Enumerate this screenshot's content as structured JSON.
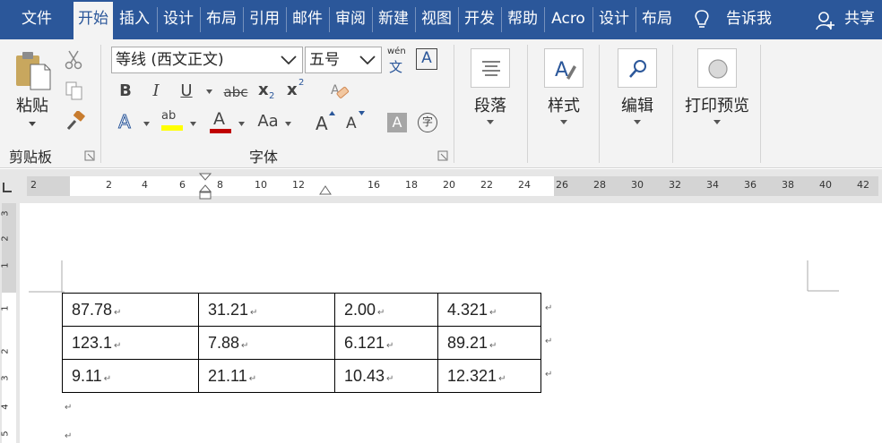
{
  "tabs": [
    {
      "label": "文件"
    },
    {
      "label": "开始"
    },
    {
      "label": "插入"
    },
    {
      "label": "设计"
    },
    {
      "label": "布局"
    },
    {
      "label": "引用"
    },
    {
      "label": "邮件"
    },
    {
      "label": "审阅"
    },
    {
      "label": "新建"
    },
    {
      "label": "视图"
    },
    {
      "label": "开发"
    },
    {
      "label": "帮助"
    },
    {
      "label": "Acro"
    },
    {
      "label": "设计"
    },
    {
      "label": "布局"
    }
  ],
  "active_tab": "开始",
  "tell_me": {
    "label": "告诉我"
  },
  "share": {
    "label": "共享"
  },
  "ribbon": {
    "clipboard": {
      "paste_label": "粘贴",
      "group_label": "剪贴板"
    },
    "font": {
      "font_name": "等线 (西文正文)",
      "font_size": "五号",
      "wen_top": "wén",
      "wen_bottom": "文",
      "boxed_a": "A",
      "bold": "B",
      "italic": "I",
      "underline": "U",
      "strike": "abc",
      "sub": "x",
      "sub_mark": "2",
      "sup": "x",
      "sup_mark": "2",
      "text_effect": "A",
      "highlight": "ab",
      "font_color": "A",
      "change_case": "Aa",
      "grow": "A",
      "shrink": "A",
      "shade_a": "A",
      "enclose": "字",
      "group_label": "字体"
    },
    "paragraph": {
      "label": "段落"
    },
    "styles": {
      "label": "样式"
    },
    "editing": {
      "label": "编辑"
    },
    "print_preview": {
      "label": "打印预览"
    }
  },
  "ruler": {
    "numbers": [
      "2",
      "2",
      "4",
      "6",
      "8",
      "10",
      "12",
      "16",
      "18",
      "20",
      "22",
      "24",
      "26",
      "28",
      "30",
      "32",
      "34",
      "36",
      "38",
      "40",
      "42"
    ]
  },
  "vruler": {
    "numbers": [
      "3",
      "2",
      "1",
      "1",
      "2",
      "3",
      "4",
      "5"
    ]
  },
  "paragraph_mark": "↵",
  "table": {
    "rows": [
      [
        "87.78",
        "31.21",
        "2.00",
        "4.321"
      ],
      [
        "123.1",
        "7.88",
        "6.121",
        "89.21"
      ],
      [
        "9.11",
        "21.11",
        "10.43",
        "12.321"
      ]
    ]
  },
  "colors": {
    "brand": "#2b579a",
    "highlight": "#ffff00",
    "font_color": "#c00000"
  }
}
